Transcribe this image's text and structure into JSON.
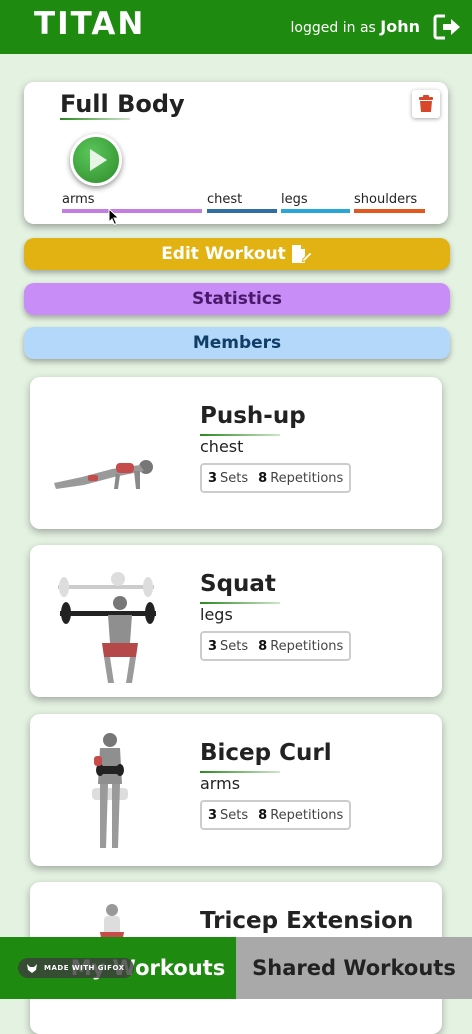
{
  "header": {
    "logo": "TITAN",
    "logged_in_prefix": "logged in as",
    "username": "John",
    "color": "#1f8a10"
  },
  "workout": {
    "title": "Full Body",
    "muscles": [
      {
        "label": "arms",
        "color": "#c47de0"
      },
      {
        "label": "chest",
        "color": "#2f6fa4"
      },
      {
        "label": "legs",
        "color": "#28a8d8"
      },
      {
        "label": "shoulders",
        "color": "#e2581e"
      }
    ]
  },
  "actions": {
    "edit": "Edit Workout",
    "statistics": "Statistics",
    "members": "Members"
  },
  "exercises": [
    {
      "name": "Push-up",
      "muscle": "chest",
      "sets": "3",
      "sets_label": "Sets",
      "reps": "8",
      "reps_label": "Repetitions"
    },
    {
      "name": "Squat",
      "muscle": "legs",
      "sets": "3",
      "sets_label": "Sets",
      "reps": "8",
      "reps_label": "Repetitions"
    },
    {
      "name": "Bicep Curl",
      "muscle": "arms",
      "sets": "3",
      "sets_label": "Sets",
      "reps": "8",
      "reps_label": "Repetitions"
    },
    {
      "name": "Tricep Extension"
    }
  ],
  "footer": {
    "my_workouts": "My Workouts",
    "shared_workouts": "Shared Workouts"
  },
  "watermark": "MADE WITH GIFOX"
}
